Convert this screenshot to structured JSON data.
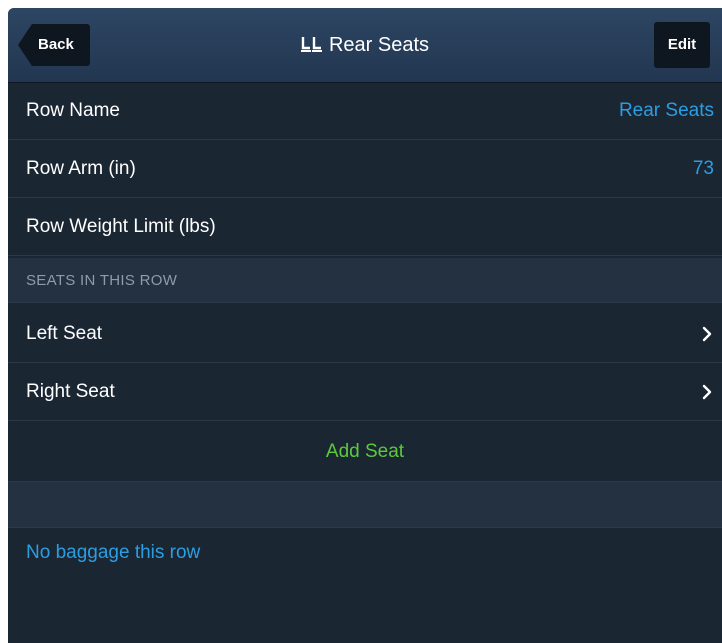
{
  "navbar": {
    "back_label": "Back",
    "title": "Rear Seats",
    "title_icon": "seat-row-icon",
    "edit_label": "Edit"
  },
  "fields": {
    "row_name": {
      "label": "Row Name",
      "value": "Rear Seats"
    },
    "row_arm": {
      "label": "Row Arm (in)",
      "value": "73"
    },
    "row_weight_limit": {
      "label": "Row Weight Limit (lbs)",
      "value": ""
    }
  },
  "seats_section": {
    "header": "SEATS IN THIS ROW",
    "seats": [
      {
        "label": "Left Seat"
      },
      {
        "label": "Right Seat"
      }
    ],
    "add_seat_label": "Add Seat"
  },
  "baggage": {
    "label": "No baggage this row"
  },
  "colors": {
    "background": "#1b2633",
    "navbar": "#2a4360",
    "accent_blue": "#2a9ee3",
    "accent_green": "#5cc93b",
    "section_header_text": "#8e9bab"
  }
}
